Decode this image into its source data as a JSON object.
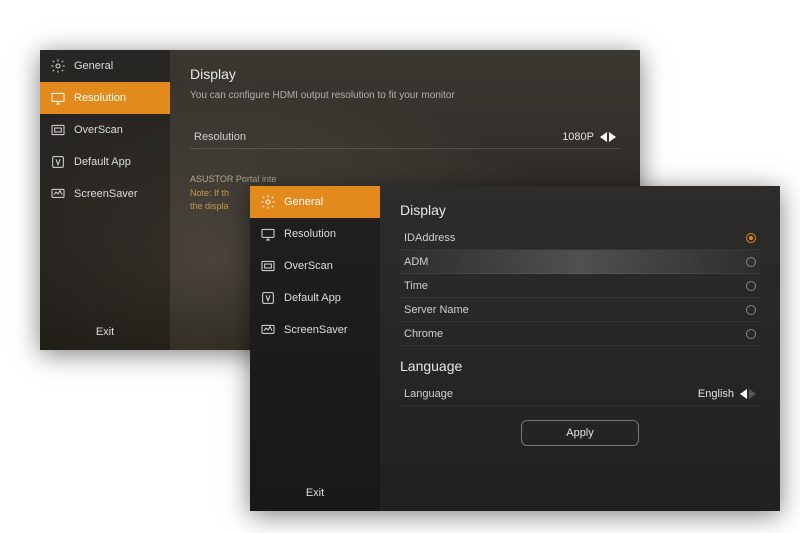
{
  "colors": {
    "accent": "#e28a1c"
  },
  "back": {
    "sidebar": {
      "items": [
        {
          "label": "General",
          "icon": "gear"
        },
        {
          "label": "Resolution",
          "icon": "monitor"
        },
        {
          "label": "OverScan",
          "icon": "overscan"
        },
        {
          "label": "Default App",
          "icon": "app"
        },
        {
          "label": "ScreenSaver",
          "icon": "screensaver"
        }
      ],
      "active_index": 1
    },
    "exit_label": "Exit",
    "main": {
      "title": "Display",
      "helper": "You can configure HDMI output resolution to fit your monitor",
      "resolution_row": {
        "label": "Resolution",
        "value": "1080P"
      },
      "note_line1": "ASUSTOR Portal inte",
      "note_line2_prefix": "Note: If th",
      "note_line3": "the displa"
    }
  },
  "front": {
    "sidebar": {
      "items": [
        {
          "label": "General",
          "icon": "gear"
        },
        {
          "label": "Resolution",
          "icon": "monitor"
        },
        {
          "label": "OverScan",
          "icon": "overscan"
        },
        {
          "label": "Default App",
          "icon": "app"
        },
        {
          "label": "ScreenSaver",
          "icon": "screensaver"
        }
      ],
      "active_index": 0
    },
    "exit_label": "Exit",
    "main": {
      "display_title": "Display",
      "display_items": [
        {
          "label": "IDAddress",
          "selected": true
        },
        {
          "label": "ADM",
          "selected": false,
          "highlight": true
        },
        {
          "label": "Time",
          "selected": false
        },
        {
          "label": "Server Name",
          "selected": false
        },
        {
          "label": "Chrome",
          "selected": false
        }
      ],
      "language_title": "Language",
      "language_row": {
        "label": "Language",
        "value": "English"
      },
      "apply_label": "Apply"
    }
  }
}
